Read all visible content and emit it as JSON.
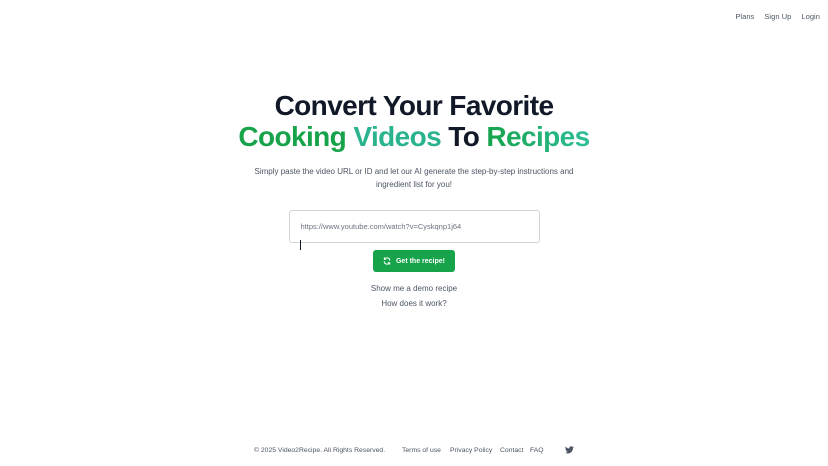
{
  "nav": {
    "plans": "Plans",
    "signup": "Sign Up",
    "login": "Login"
  },
  "hero": {
    "line1": "Convert Your Favorite",
    "line2_a": "Cooking",
    "line2_b": "Videos",
    "line2_c": "To",
    "line2_d": "Recipes",
    "subtitle": "Simply paste the video URL or ID and let our AI generate the step-by-step instructions and ingredient list for you!"
  },
  "form": {
    "url_placeholder": "https://www.youtube.com/watch?v=Cyskqnp1j64",
    "url_value": "",
    "submit_label": "Get the recipe!"
  },
  "links": {
    "demo": "Show me a demo recipe",
    "how": "How does it work?"
  },
  "footer": {
    "copyright": "© 2025 Video2Recipe. All Rights Reserved.",
    "terms": "Terms of use",
    "privacy": "Privacy Policy",
    "contact": "Contact",
    "faq": "FAQ"
  },
  "colors": {
    "brand_green": "#16a34a",
    "accent_teal": "#2ab38e",
    "heading": "#111827"
  },
  "icons": {
    "submit": "refresh-icon",
    "social": "twitter-icon"
  }
}
